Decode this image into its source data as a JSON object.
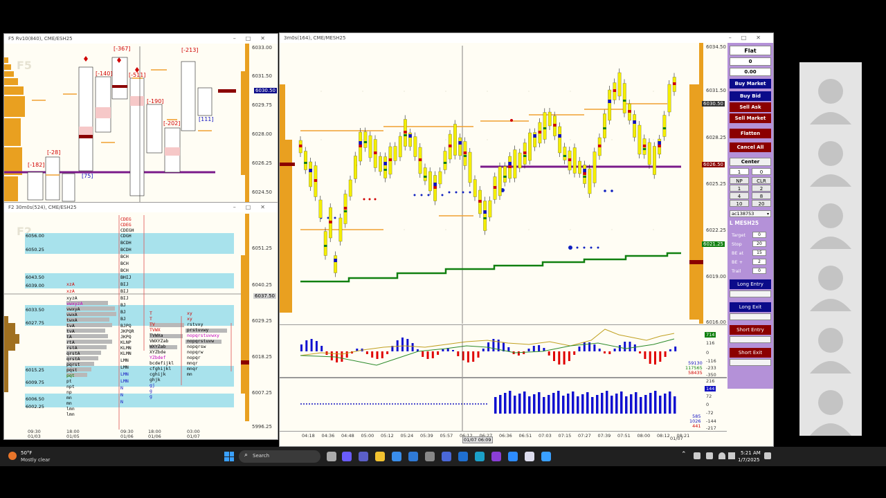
{
  "win_f5": {
    "title": "F5 Rv10(840), CME/ESH25",
    "watermark": "F5",
    "prices": [
      "6033.00",
      "6031.50",
      "6029.75",
      "6028.00",
      "6026.25",
      "6024.50"
    ],
    "current": "6030.50",
    "labels": [
      "[-367]",
      "[-213]",
      "[-140]",
      "[-511]",
      "[-190]",
      "[-202]",
      "[-182]",
      "[-28]",
      "[111]",
      "[75]"
    ]
  },
  "win_f2": {
    "title": "F2 30m0s(524), CME/ESH25",
    "watermark": "F2",
    "prices": [
      "6051.25",
      "6040.25",
      "6029.25",
      "6018.25",
      "6007.25",
      "5996.25"
    ],
    "level_labels": [
      "6056.00",
      "6050.25",
      "6043.50",
      "6039.00",
      "6033.50",
      "6027.75",
      "6015.25",
      "6009.75",
      "6006.50",
      "6002.25"
    ],
    "current": "6037.50",
    "time_labels": [
      "09:30\n01/03",
      "18:00\n01/05",
      "09:30\n01/06",
      "18:00\n01/06",
      "03:00\n01/07"
    ]
  },
  "win_main": {
    "title": "3m0s(164), CME/MESH25",
    "prices": [
      "6034.50",
      "6031.50",
      "6028.25",
      "6025.25",
      "6022.25",
      "6019.00",
      "6016.00"
    ],
    "tags": {
      "a": "6030.50",
      "b": "6026.50",
      "c": "6021.25"
    },
    "ind1": [
      "714",
      "116",
      "0",
      "-116",
      "-233",
      "-350"
    ],
    "ind1_vals": [
      "59130",
      "117565",
      "58435"
    ],
    "ind2": [
      "216",
      "144",
      "72",
      "0",
      "-72",
      "-144",
      "-217"
    ],
    "ind2_vals": [
      "585",
      "1026",
      "441"
    ],
    "times": [
      "04:18",
      "04:36",
      "04:48",
      "05:00",
      "05:12",
      "05:24",
      "05:39",
      "05:57",
      "06:12",
      "06:27",
      "06:36",
      "06:51",
      "07:03",
      "07:15",
      "07:27",
      "07:39",
      "07:51",
      "08:00",
      "08:12",
      "08:21"
    ],
    "cursor_time": "01/07 06:09",
    "last_date": "01/07"
  },
  "panel": {
    "position": "Flat",
    "qty": "0",
    "pnl": "0.00",
    "buy_market": "Buy Market",
    "buy_bid": "Buy Bid",
    "sell_ask": "Sell Ask",
    "sell_market": "Sell Market",
    "flatten": "Flatten",
    "cancel_all": "Cancel All",
    "center": "Center",
    "grid": [
      "1",
      "0",
      "NP",
      "CLR",
      "1",
      "2",
      "4",
      "8",
      "10",
      "20"
    ],
    "account": "ac138753",
    "symbol": "L MESH25",
    "target_label": "Target",
    "target": "0",
    "stop_label": "Stop",
    "stop": "20",
    "beat_label": "BE at",
    "beat": "15",
    "beplus_label": "BE +",
    "beplus": "2",
    "trail_label": "Trail",
    "trail": "0",
    "long_entry": "Long Entry",
    "long_exit": "Long Exit",
    "short_entry": "Short Entry",
    "short_exit": "Short Exit"
  },
  "taskbar": {
    "weather_temp": "50°F",
    "weather_desc": "Mostly clear",
    "search": "Search",
    "time": "5:21 AM",
    "date": "1/7/2025"
  },
  "colors": {
    "accent_blue": "#0000c8",
    "buy": "#0b0b8a",
    "sell": "#8b0000",
    "bar_yellow": "#f4ee00",
    "panel": "#b491d8"
  }
}
